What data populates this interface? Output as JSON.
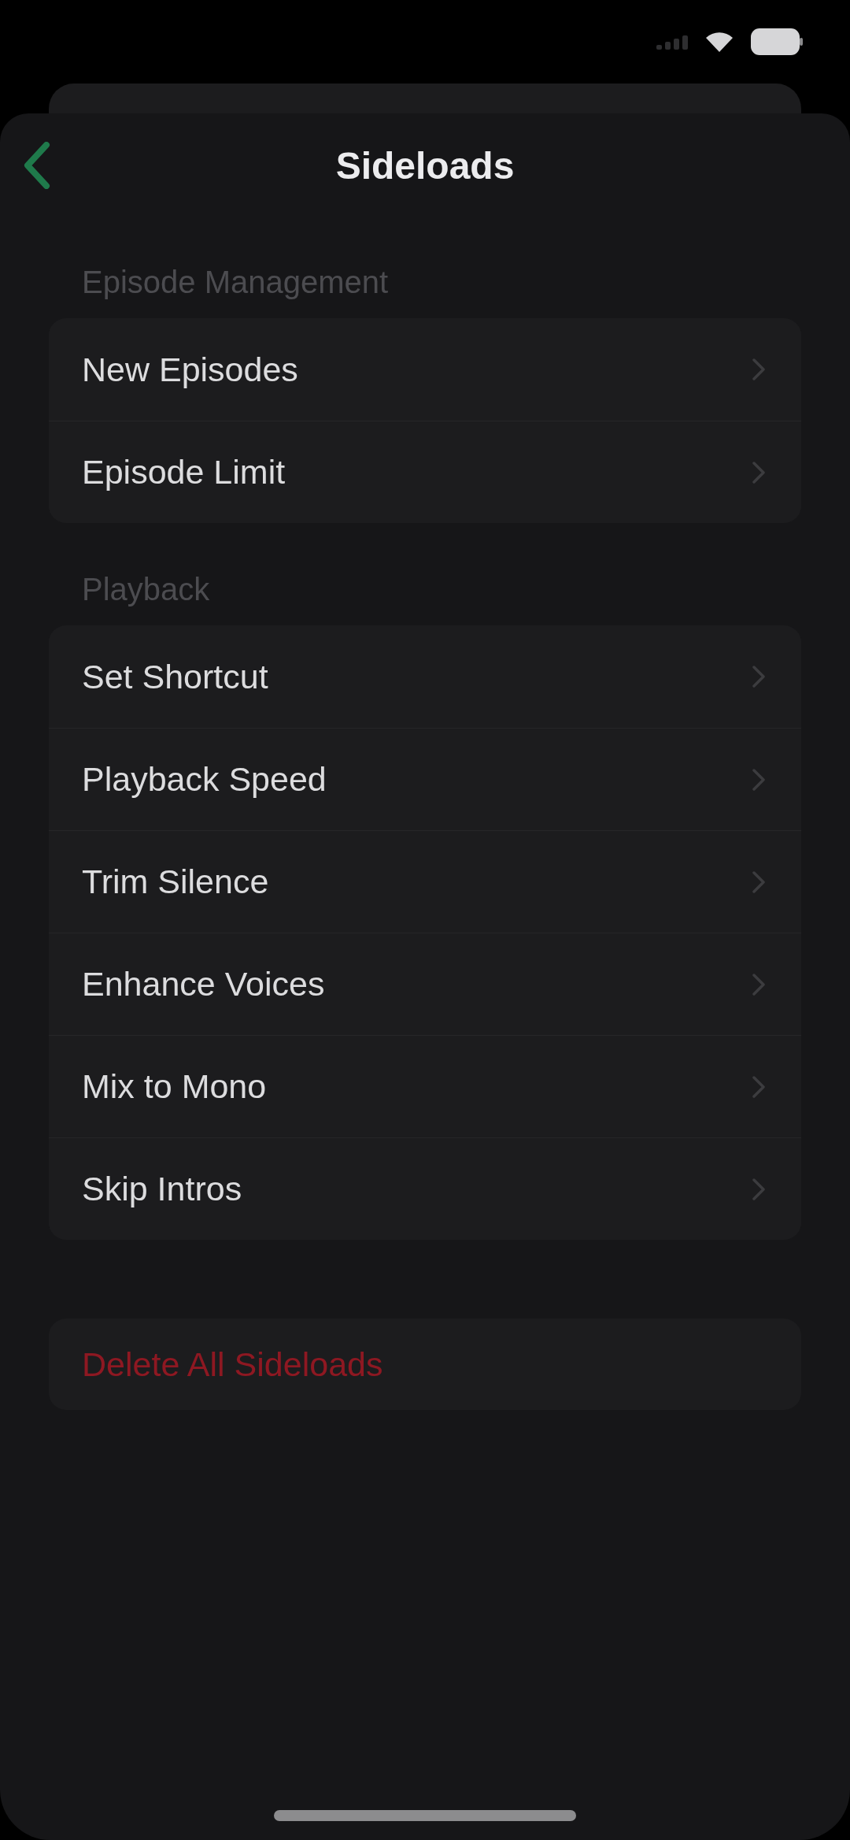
{
  "header": {
    "title": "Sideloads"
  },
  "sections": [
    {
      "title": "Episode Management",
      "items": [
        {
          "label": "New Episodes"
        },
        {
          "label": "Episode Limit"
        }
      ]
    },
    {
      "title": "Playback",
      "items": [
        {
          "label": "Set Shortcut"
        },
        {
          "label": "Playback Speed"
        },
        {
          "label": "Trim Silence"
        },
        {
          "label": "Enhance Voices"
        },
        {
          "label": "Mix to Mono"
        },
        {
          "label": "Skip Intros"
        }
      ]
    }
  ],
  "danger_action": {
    "label": "Delete All Sideloads"
  }
}
